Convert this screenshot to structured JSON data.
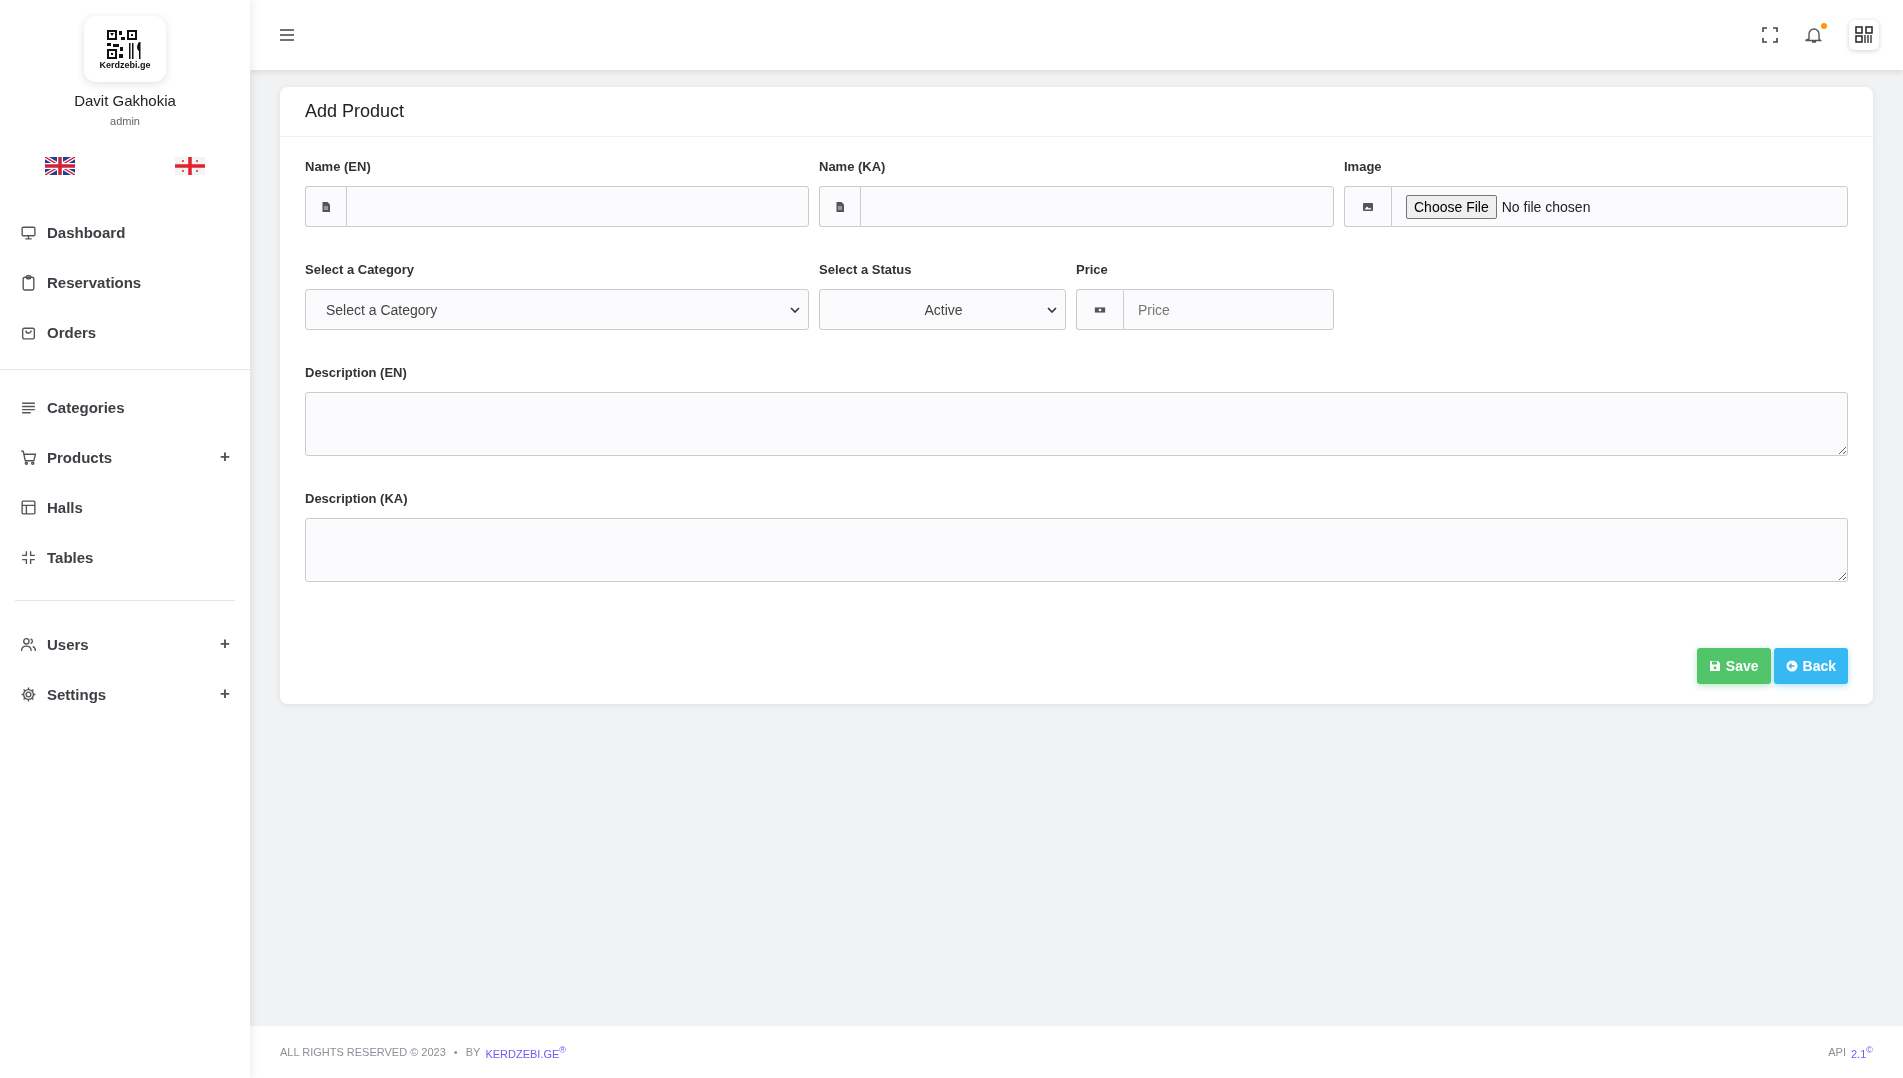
{
  "sidebar": {
    "profile": {
      "logo_text": "Kerdzebi.ge",
      "name": "Davit Gakhokia",
      "role": "admin"
    },
    "nav_groups": [
      [
        {
          "label": "Dashboard"
        },
        {
          "label": "Reservations"
        },
        {
          "label": "Orders"
        }
      ],
      [
        {
          "label": "Categories"
        },
        {
          "label": "Products",
          "toggle": "+"
        },
        {
          "label": "Halls"
        },
        {
          "label": "Tables"
        }
      ],
      [
        {
          "label": "Users",
          "toggle": "+"
        },
        {
          "label": "Settings",
          "toggle": "+"
        }
      ]
    ]
  },
  "topbar": {
    "unread_notifications": true
  },
  "form": {
    "title": "Add Product",
    "name_en": {
      "label": "Name (EN)"
    },
    "name_ka": {
      "label": "Name (KA)"
    },
    "image": {
      "label": "Image",
      "button": "Choose File",
      "status": "No file chosen"
    },
    "category": {
      "label": "Select a Category",
      "value": "Select a Category"
    },
    "status": {
      "label": "Select a Status",
      "value": "Active"
    },
    "price": {
      "label": "Price",
      "placeholder": "Price"
    },
    "description_en": {
      "label": "Description (EN)"
    },
    "description_ka": {
      "label": "Description (KA)"
    },
    "buttons": [
      {
        "label": "Save",
        "kind": "save"
      },
      {
        "label": "Back",
        "kind": "back"
      }
    ]
  },
  "footer": {
    "copyright": "ALL RIGHTS RESERVED © 2023",
    "separator": "•",
    "by": "BY",
    "brand": "KERDZEBI.GE$^{®}$",
    "api_label": "API",
    "api_version": "2.1$^{©}$"
  }
}
